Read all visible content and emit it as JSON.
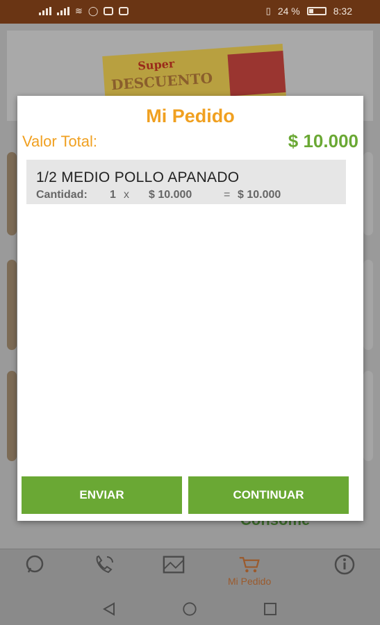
{
  "status_bar": {
    "battery_percent": "24 %",
    "battery_level": 0.24,
    "time": "8:32"
  },
  "background": {
    "banner_text_1": "Super",
    "banner_text_2": "DESCUENTO",
    "visible_item_text": "Consome"
  },
  "bottom_nav": {
    "items": [
      {
        "icon": "whatsapp-icon",
        "label": ""
      },
      {
        "icon": "phone-icon",
        "label": ""
      },
      {
        "icon": "map-icon",
        "label": ""
      },
      {
        "icon": "cart-icon",
        "label": "Mi Pedido"
      },
      {
        "icon": "info-icon",
        "label": ""
      }
    ]
  },
  "dialog": {
    "title": "Mi Pedido",
    "total_label": "Valor Total:",
    "total_value": "$ 10.000",
    "items": [
      {
        "name": "1/2 MEDIO POLLO APANADO",
        "quantity_label": "Cantidad:",
        "quantity": "1",
        "times": "x",
        "unit_price": "$ 10.000",
        "equals": "=",
        "line_total": "$ 10.000"
      }
    ],
    "send_button": "ENVIAR",
    "continue_button": "CONTINUAR"
  },
  "colors": {
    "status_bar": "#6a3514",
    "accent_orange": "#f0a020",
    "accent_green": "#6aa834"
  }
}
